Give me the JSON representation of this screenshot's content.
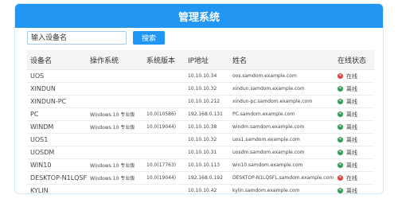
{
  "window": {
    "title": "管理系统"
  },
  "search": {
    "placeholder": "输入设备名",
    "button_label": "搜索"
  },
  "table": {
    "headers": [
      "设备名",
      "操作系统",
      "系统版本",
      "IP地址",
      "姓名",
      "在线状态"
    ],
    "rows": [
      {
        "device": "UOS",
        "os": "",
        "version": "",
        "ip": "10.10.10.34",
        "host": "oos.samdom.example.com",
        "status": "在线",
        "online": true
      },
      {
        "device": "XINDUN",
        "os": "",
        "version": "",
        "ip": "10.10.10.32",
        "host": "xindun.samdom.example.com",
        "status": "离线",
        "online": false
      },
      {
        "device": "XINDUN-PC",
        "os": "",
        "version": "",
        "ip": "10.10.10.212",
        "host": "xindun-pc.samdom.example.com",
        "status": "离线",
        "online": false
      },
      {
        "device": "PC",
        "os": "Windows 10 专业版",
        "version": "10.0(10586)",
        "ip": "192.168.0.131",
        "host": "PC.samdom.example.com",
        "status": "离线",
        "online": false
      },
      {
        "device": "WINDM",
        "os": "Windows 10 专业版",
        "version": "10.0(19044)",
        "ip": "10.10.10.38",
        "host": "windm.samdom.example.com",
        "status": "离线",
        "online": false
      },
      {
        "device": "UOS1",
        "os": "",
        "version": "",
        "ip": "10.10.10.32",
        "host": "uos1.samdom.example.com",
        "status": "离线",
        "online": false
      },
      {
        "device": "UOSDM",
        "os": "",
        "version": "",
        "ip": "10.10.10.31",
        "host": "uosdm.samdom.example.com",
        "status": "离线",
        "online": false
      },
      {
        "device": "WIN10",
        "os": "Windows 10 专业版",
        "version": "10.0(17763)",
        "ip": "10.10.10.113",
        "host": "win10.samdom.example.com",
        "status": "离线",
        "online": false
      },
      {
        "device": "DESKTOP-N1LQSFI",
        "os": "Windows 10 专业版",
        "version": "10.0(19044)",
        "ip": "192.168.0.192",
        "host": "DESKTOP-N1LQSFL.samdom.example.com",
        "status": "在线",
        "online": true
      },
      {
        "device": "KYLIN",
        "os": "",
        "version": "",
        "ip": "10.10.10.42",
        "host": "kylin.samdom.example.com",
        "status": "离线",
        "online": false
      }
    ]
  },
  "colors": {
    "accent": "#2196f3",
    "online": "#e0423c",
    "offline": "#2e9b5b"
  },
  "icons": {
    "online": "x-circle-icon",
    "offline": "x-circle-icon"
  }
}
